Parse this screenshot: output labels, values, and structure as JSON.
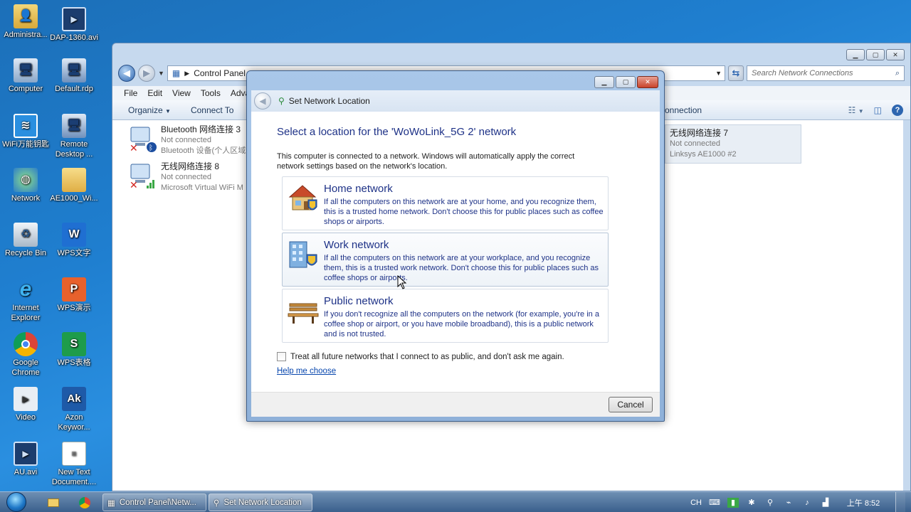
{
  "desktop": {
    "icons": [
      {
        "label": "Administra...",
        "icon": "user-folder-icon"
      },
      {
        "label": "DAP-1360.avi",
        "icon": "video-file-icon"
      },
      {
        "label": "Computer",
        "icon": "computer-icon"
      },
      {
        "label": "Default.rdp",
        "icon": "remote-desktop-file-icon"
      },
      {
        "label": "WiFi万能钥匙",
        "icon": "wifi-key-icon"
      },
      {
        "label": "Remote Desktop ...",
        "icon": "remote-desktop-icon"
      },
      {
        "label": "Network",
        "icon": "network-icon"
      },
      {
        "label": "AE1000_Wi...",
        "icon": "folder-icon"
      },
      {
        "label": "Recycle Bin",
        "icon": "recycle-bin-icon"
      },
      {
        "label": "WPS文字",
        "icon": "wps-writer-icon"
      },
      {
        "label": "Internet Explorer",
        "icon": "internet-explorer-icon"
      },
      {
        "label": "WPS演示",
        "icon": "wps-presentation-icon"
      },
      {
        "label": "Google Chrome",
        "icon": "chrome-icon"
      },
      {
        "label": "WPS表格",
        "icon": "wps-spreadsheet-icon"
      },
      {
        "label": "Video",
        "icon": "video-shortcut-icon"
      },
      {
        "label": "Azon Keywor...",
        "icon": "azon-icon"
      },
      {
        "label": "AU.avi",
        "icon": "video-file-icon"
      },
      {
        "label": "New Text Document....",
        "icon": "text-document-icon"
      }
    ]
  },
  "explorer": {
    "breadcrumb": "Control Panel",
    "search_placeholder": "Search Network Connections",
    "menu": [
      "File",
      "Edit",
      "View",
      "Tools",
      "Adva"
    ],
    "commands": {
      "organize": "Organize",
      "connect_to": "Connect To",
      "right_fragment": "onnection"
    },
    "connections": [
      {
        "name": "Bluetooth 网络连接 3",
        "status": "Not connected",
        "device": "Bluetooth 设备(个人区域"
      },
      {
        "name": "无线网络连接 8",
        "status": "Not connected",
        "device": "Microsoft Virtual WiFi M"
      },
      {
        "name": "无线网络连接 7",
        "status": "Not connected",
        "device": "Linksys AE1000 #2"
      }
    ]
  },
  "dialog": {
    "title": "Set Network Location",
    "heading": "Select a location for the 'WoWoLink_5G  2' network",
    "intro": "This computer is connected to a network. Windows will automatically apply the correct network settings based on the network's location.",
    "options": [
      {
        "title": "Home network",
        "description": "If all the computers on this network are at your home, and you recognize them, this is a trusted home network.  Don't choose this for public places such as coffee shops or airports."
      },
      {
        "title": "Work network",
        "description": "If all the computers on this network are at your workplace, and you recognize them, this is a trusted work network.  Don't choose this for public places such as coffee shops or airports."
      },
      {
        "title": "Public network",
        "description": "If you don't recognize all the computers on the network (for example, you're in a coffee shop or airport, or you have mobile broadband), this is a public network and is not trusted."
      }
    ],
    "checkbox_label": "Treat all future networks that I connect to as public, and don't ask me again.",
    "help_link": "Help me choose",
    "cancel": "Cancel"
  },
  "taskbar": {
    "buttons": [
      "Control Panel\\Netw...",
      "Set Network Location"
    ],
    "tray_lang": "CH",
    "clock": "上午 8:52"
  },
  "colors": {
    "desktop": "#1f7fd0",
    "heading_blue": "#1e3287",
    "link_blue": "#0645ad"
  }
}
